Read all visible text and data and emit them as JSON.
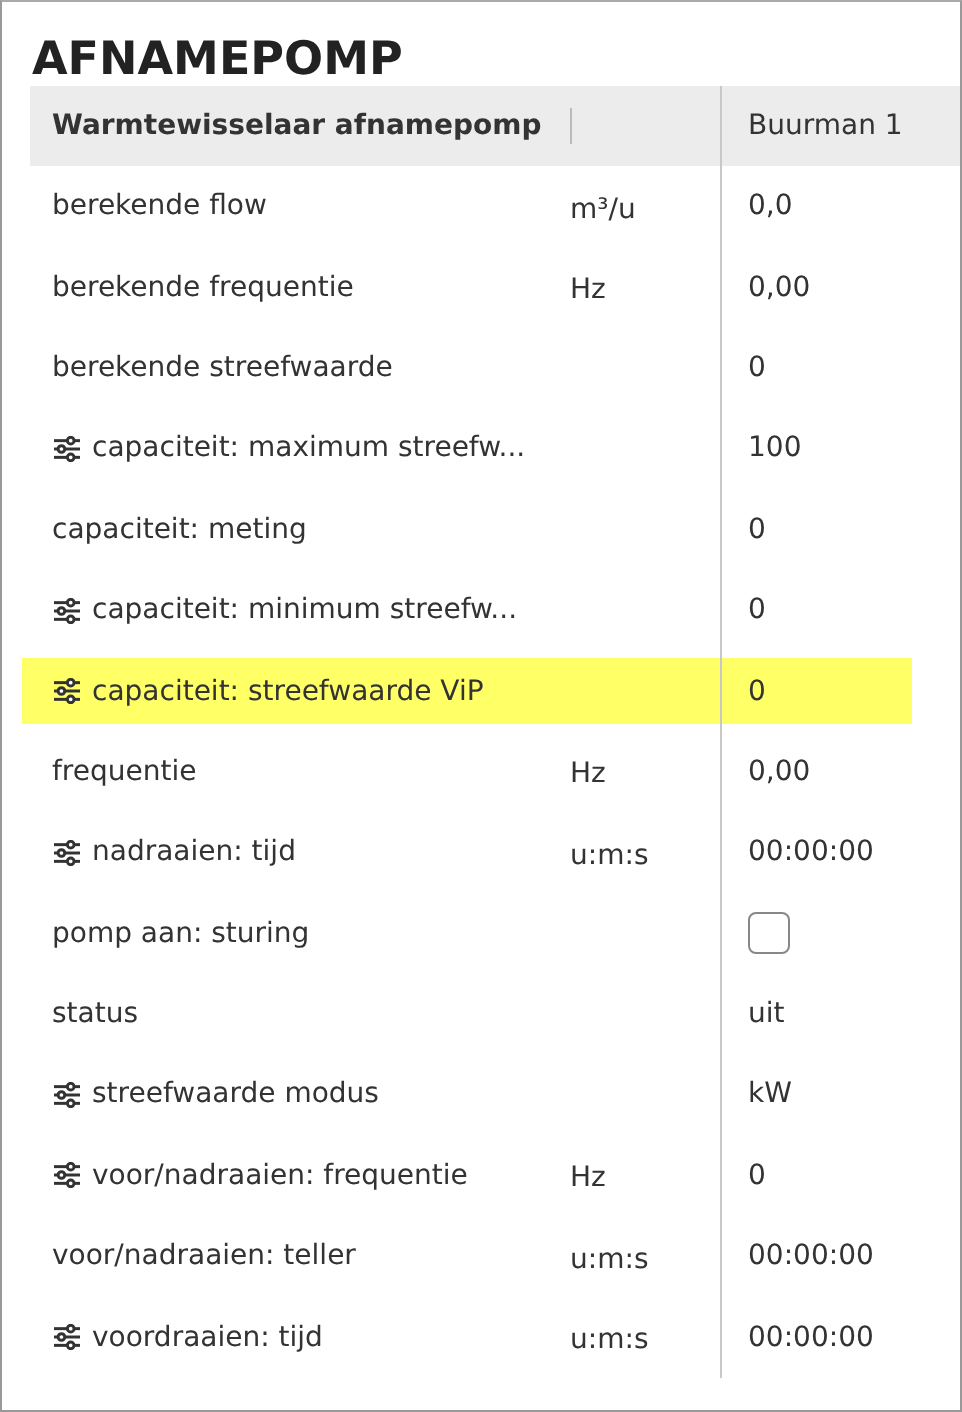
{
  "title": "AFNAMEPOMP",
  "table": {
    "header": {
      "label": "Warmtewisselaar afnamepomp",
      "column": "Buurman 1"
    },
    "rows": [
      {
        "label": "berekende flow",
        "unit": "m³/u",
        "kind": "text",
        "value": "0,0",
        "settable": false,
        "highlighted": false
      },
      {
        "label": "berekende frequentie",
        "unit": "Hz",
        "kind": "text",
        "value": "0,00",
        "settable": false,
        "highlighted": false
      },
      {
        "label": "berekende streefwaarde",
        "kind": "text",
        "value": "0",
        "settable": false,
        "highlighted": false
      },
      {
        "label": "capaciteit: maximum streefw...",
        "kind": "text",
        "value": "100",
        "settable": true,
        "highlighted": false
      },
      {
        "label": "capaciteit: meting",
        "kind": "text",
        "value": "0",
        "settable": false,
        "highlighted": false
      },
      {
        "label": "capaciteit: minimum streefw...",
        "kind": "text",
        "value": "0",
        "settable": true,
        "highlighted": false
      },
      {
        "label": "capaciteit: streefwaarde ViP",
        "kind": "text",
        "value": "0",
        "settable": true,
        "highlighted": true
      },
      {
        "label": "frequentie",
        "unit": "Hz",
        "kind": "text",
        "value": "0,00",
        "settable": false,
        "highlighted": false
      },
      {
        "label": "nadraaien: tijd",
        "unit": "u:m:s",
        "kind": "text",
        "value": "00:00:00",
        "settable": true,
        "highlighted": false
      },
      {
        "label": "pomp aan: sturing",
        "kind": "checkbox",
        "checked": false,
        "settable": false,
        "highlighted": false
      },
      {
        "label": "status",
        "kind": "text",
        "value": "uit",
        "settable": false,
        "highlighted": false
      },
      {
        "label": "streefwaarde modus",
        "kind": "text",
        "value": "kW",
        "settable": true,
        "highlighted": false
      },
      {
        "label": "voor/nadraaien: frequentie",
        "unit": "Hz",
        "kind": "text",
        "value": "0",
        "settable": true,
        "highlighted": false
      },
      {
        "label": "voor/nadraaien: teller",
        "unit": "u:m:s",
        "kind": "text",
        "value": "00:00:00",
        "settable": false,
        "highlighted": false
      },
      {
        "label": "voordraaien: tijd",
        "unit": "u:m:s",
        "kind": "text",
        "value": "00:00:00",
        "settable": true,
        "highlighted": false
      }
    ]
  }
}
